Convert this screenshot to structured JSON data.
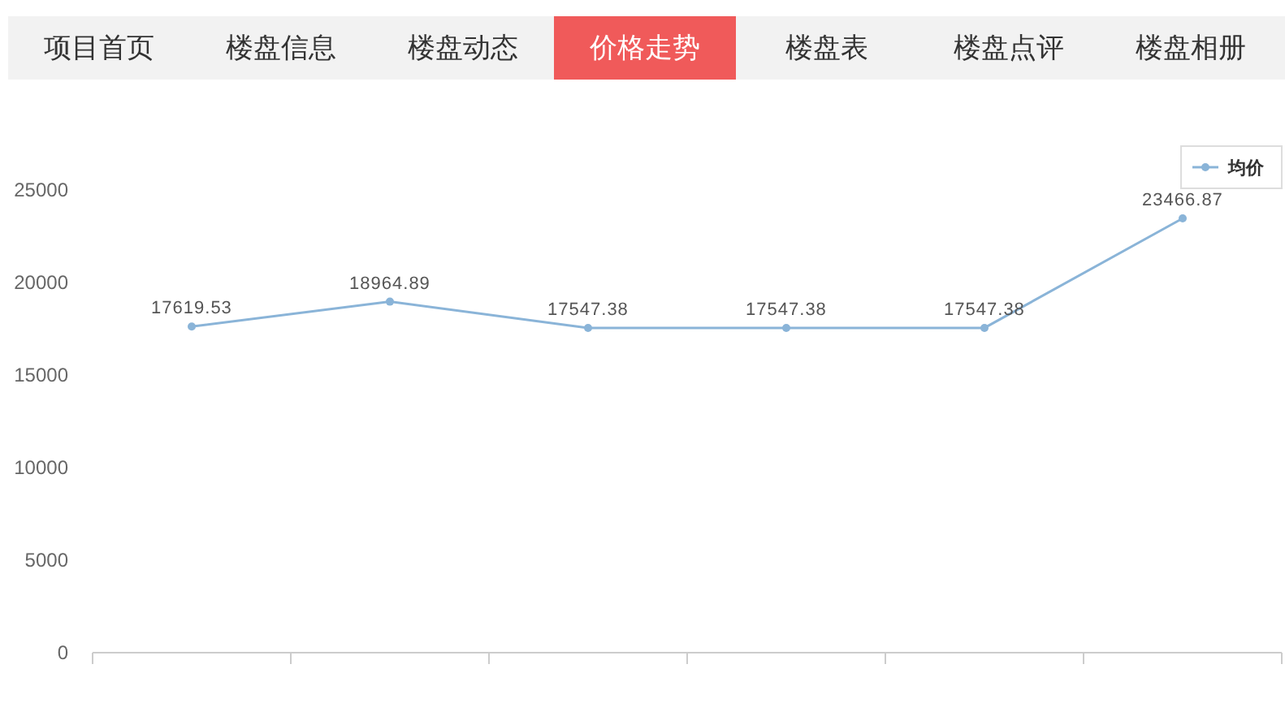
{
  "tabs": [
    {
      "label": "项目首页",
      "selected": false
    },
    {
      "label": "楼盘信息",
      "selected": false
    },
    {
      "label": "楼盘动态",
      "selected": false
    },
    {
      "label": "价格走势",
      "selected": true
    },
    {
      "label": "楼盘表",
      "selected": false
    },
    {
      "label": "楼盘点评",
      "selected": false
    },
    {
      "label": "楼盘相册",
      "selected": false
    }
  ],
  "chart_data": {
    "type": "line",
    "yticks": [
      0,
      5000,
      10000,
      15000,
      20000,
      25000
    ],
    "ylim": [
      0,
      25000
    ],
    "data_labels": true,
    "series": [
      {
        "name": "均价",
        "color": "#8ab4d8",
        "marker": "circle",
        "values": [
          17619.53,
          18964.89,
          17547.38,
          17547.38,
          17547.38,
          23466.87
        ]
      }
    ]
  }
}
